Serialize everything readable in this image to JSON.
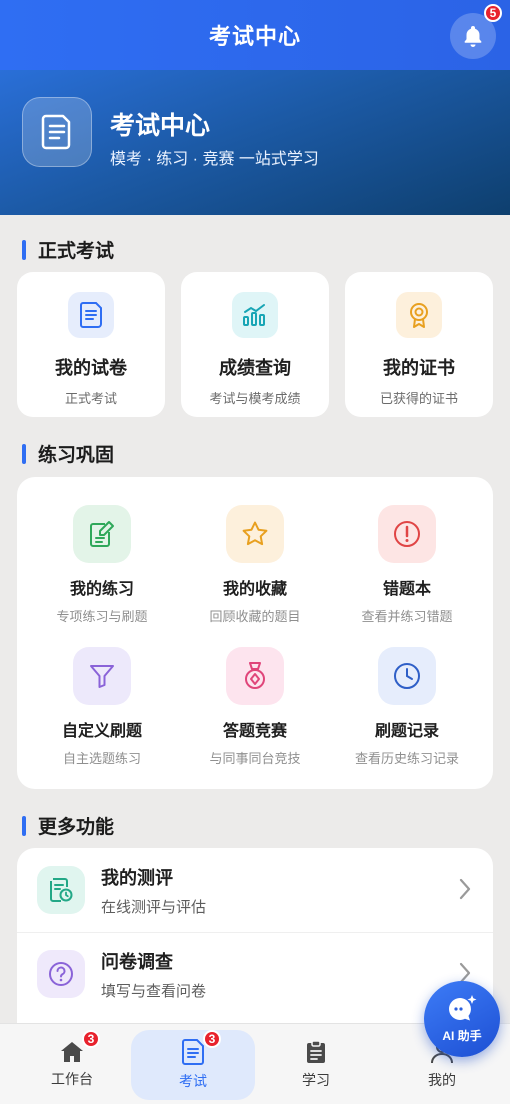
{
  "topbar": {
    "title": "考试中心",
    "notification_count": "5"
  },
  "hero": {
    "title": "考试中心",
    "subtitle": "模考 · 练习 · 竞赛 一站式学习"
  },
  "formal": {
    "title": "正式考试",
    "items": [
      {
        "name": "我的试卷",
        "desc": "正式考试",
        "icon": "document-icon"
      },
      {
        "name": "成绩查询",
        "desc": "考试与模考成绩",
        "icon": "bar-chart-icon"
      },
      {
        "name": "我的证书",
        "desc": "已获得的证书",
        "icon": "award-icon"
      }
    ]
  },
  "practice": {
    "title": "练习巩固",
    "items": [
      {
        "name": "我的练习",
        "desc": "专项练习与刷题",
        "icon": "edit-note-icon"
      },
      {
        "name": "我的收藏",
        "desc": "回顾收藏的题目",
        "icon": "star-icon"
      },
      {
        "name": "错题本",
        "desc": "查看并练习错题",
        "icon": "alert-circle-icon"
      },
      {
        "name": "自定义刷题",
        "desc": "自主选题练习",
        "icon": "filter-icon"
      },
      {
        "name": "答题竞赛",
        "desc": "与同事同台竞技",
        "icon": "medal-icon"
      },
      {
        "name": "刷题记录",
        "desc": "查看历史练习记录",
        "icon": "clock-icon"
      }
    ]
  },
  "more": {
    "title": "更多功能",
    "items": [
      {
        "name": "我的测评",
        "desc": "在线测评与评估",
        "icon": "assessment-icon"
      },
      {
        "name": "问卷调查",
        "desc": "填写与查看问卷",
        "icon": "question-circle-icon"
      }
    ]
  },
  "ai": {
    "label": "AI 助手"
  },
  "tabs": [
    {
      "label": "工作台",
      "badge": "3",
      "icon": "home-icon"
    },
    {
      "label": "考试",
      "badge": "3",
      "icon": "exam-icon",
      "active": true
    },
    {
      "label": "学习",
      "icon": "clipboard-icon"
    },
    {
      "label": "我的",
      "icon": "user-icon"
    }
  ],
  "colors": {
    "primary": "#2f6ef3",
    "badge": "#e8222d"
  }
}
